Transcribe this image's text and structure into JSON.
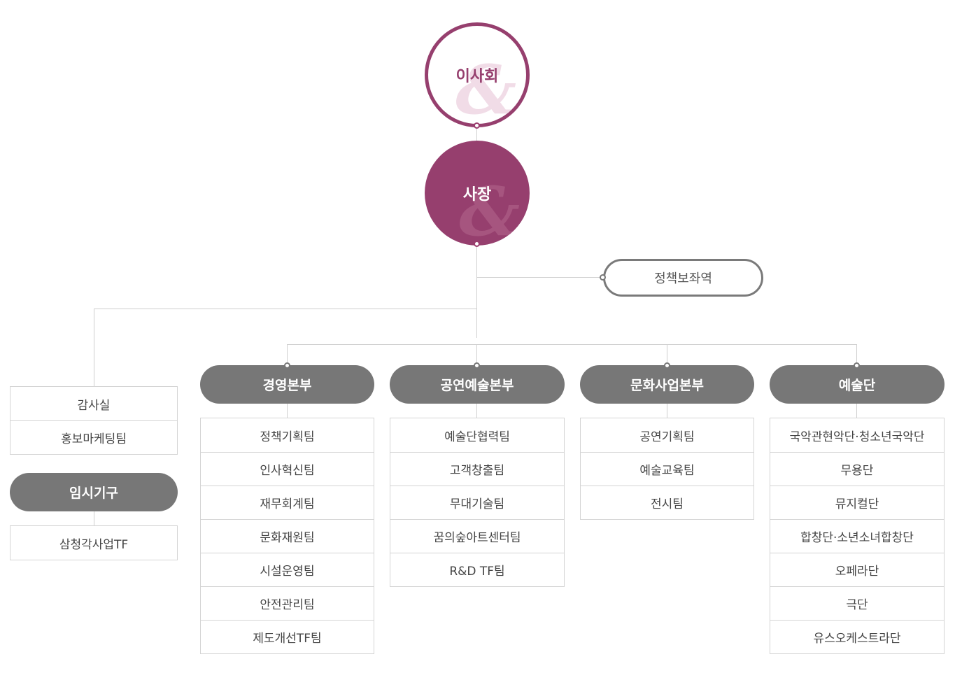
{
  "board": {
    "label": "이사회"
  },
  "president": {
    "label": "사장"
  },
  "advisor": {
    "label": "정책보좌역"
  },
  "audit": {
    "items": [
      "감사실",
      "홍보마케팅팀"
    ]
  },
  "temporary": {
    "title": "임시기구",
    "items": [
      "삼청각사업TF"
    ]
  },
  "divisions": [
    {
      "title": "경영본부",
      "teams": [
        "정책기획팀",
        "인사혁신팀",
        "재무회계팀",
        "문화재원팀",
        "시설운영팀",
        "안전관리팀",
        "제도개선TF팀"
      ]
    },
    {
      "title": "공연예술본부",
      "teams": [
        "예술단협력팀",
        "고객창출팀",
        "무대기술팀",
        "꿈의숲아트센터팀",
        "R&D TF팀"
      ]
    },
    {
      "title": "문화사업본부",
      "teams": [
        "공연기획팀",
        "예술교육팀",
        "전시팀"
      ]
    },
    {
      "title": "예술단",
      "teams": [
        "국악관현악단·청소년국악단",
        "무용단",
        "뮤지컬단",
        "합창단·소년소녀합창단",
        "오페라단",
        "극단",
        "유스오케스트라단"
      ]
    }
  ],
  "colors": {
    "accent": "#963f6e",
    "gray": "#777777",
    "line": "#cfcfcf"
  }
}
